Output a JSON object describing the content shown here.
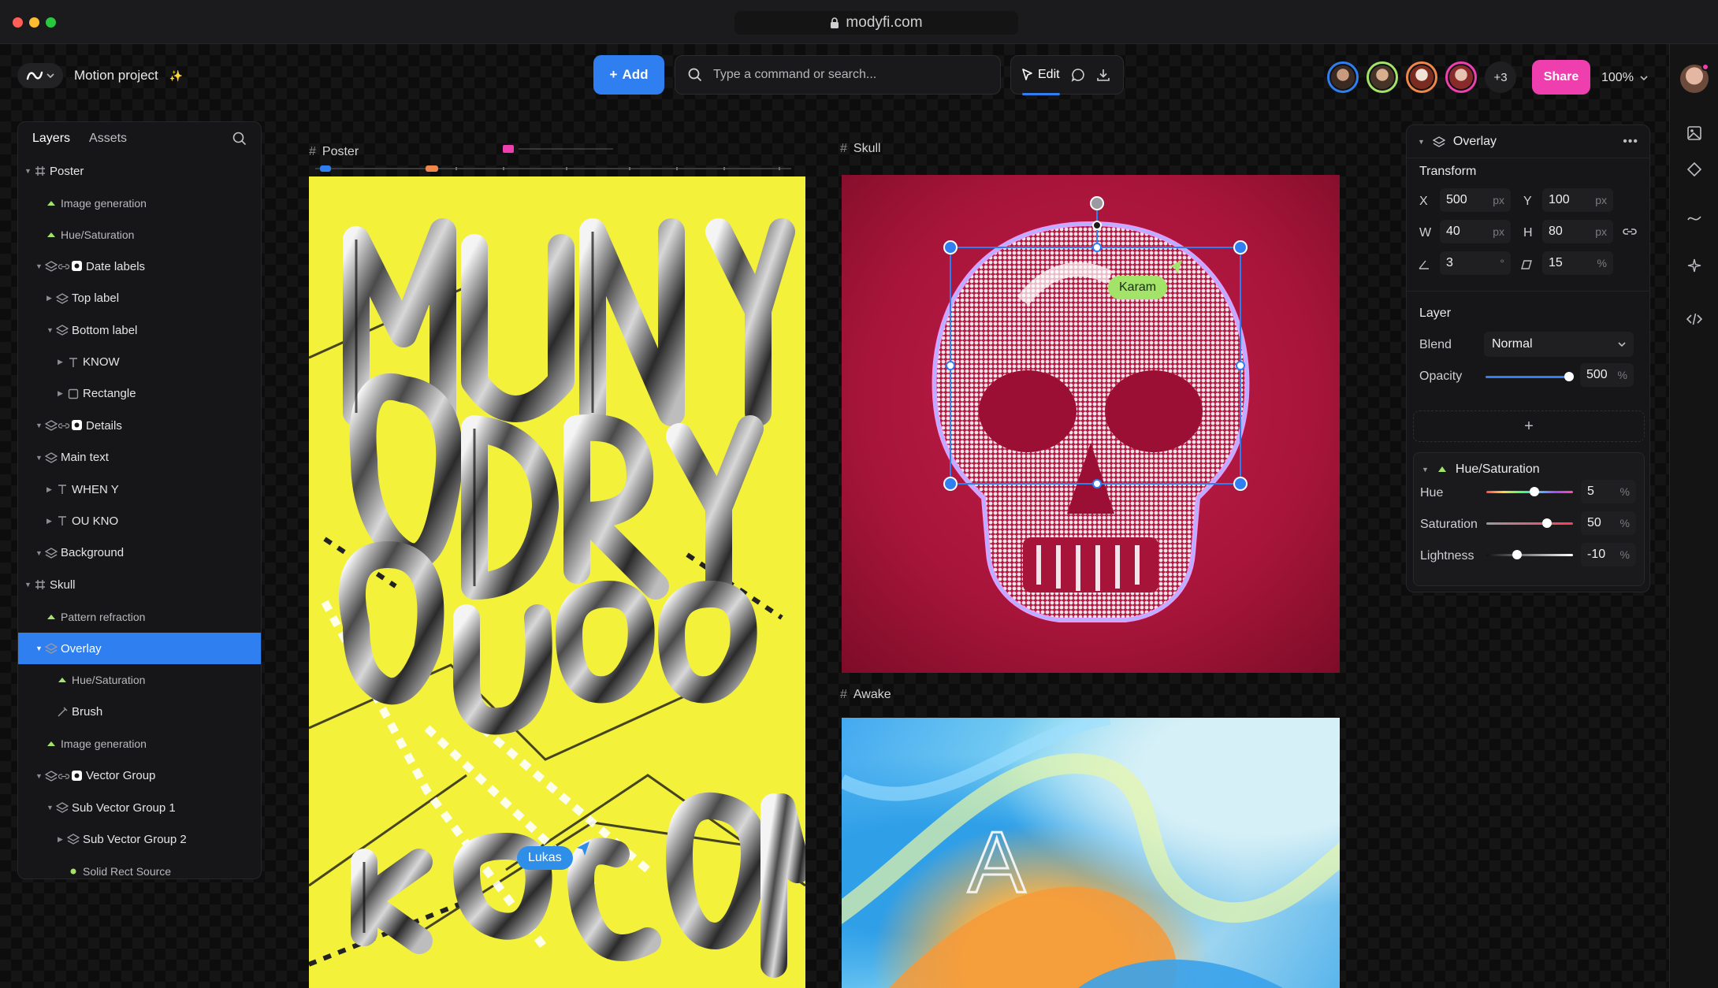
{
  "browser": {
    "url": "modyfi.com"
  },
  "header": {
    "project_title": "Motion project",
    "add_label": "Add",
    "search_placeholder": "Type a command or search...",
    "edit_label": "Edit",
    "avatars_more": "+3",
    "share_label": "Share",
    "zoom": "100%"
  },
  "layers": {
    "tabs": [
      "Layers",
      "Assets"
    ],
    "items": [
      {
        "label": "Poster",
        "type": "frame",
        "depth": 0,
        "caret": true
      },
      {
        "label": "Image generation",
        "type": "gen",
        "depth": 1,
        "caret": false,
        "small": true
      },
      {
        "label": "Hue/Saturation",
        "type": "adjust",
        "depth": 1,
        "caret": false,
        "small": true
      },
      {
        "label": "Date labels",
        "type": "group-linked",
        "depth": 1,
        "caret": true
      },
      {
        "label": "Top label",
        "type": "stack",
        "depth": 2,
        "caret": true
      },
      {
        "label": "Bottom label",
        "type": "stack",
        "depth": 2,
        "caret": true
      },
      {
        "label": "KNOW",
        "type": "text",
        "depth": 3,
        "caret": true
      },
      {
        "label": "Rectangle",
        "type": "rect",
        "depth": 3,
        "caret": true
      },
      {
        "label": "Details",
        "type": "group-linked",
        "depth": 1,
        "caret": true
      },
      {
        "label": "Main text",
        "type": "stack",
        "depth": 1,
        "caret": true
      },
      {
        "label": "WHEN Y",
        "type": "text",
        "depth": 2,
        "caret": true
      },
      {
        "label": "OU KNO",
        "type": "text",
        "depth": 2,
        "caret": true
      },
      {
        "label": "Background",
        "type": "stack",
        "depth": 1,
        "caret": true
      },
      {
        "label": "Skull",
        "type": "frame",
        "depth": 0,
        "caret": true
      },
      {
        "label": "Pattern refraction",
        "type": "gen",
        "depth": 1,
        "caret": false,
        "small": true
      },
      {
        "label": "Overlay",
        "type": "stack",
        "depth": 1,
        "caret": true,
        "selected": true
      },
      {
        "label": "Hue/Saturation",
        "type": "adjust",
        "depth": 2,
        "caret": false,
        "small": true
      },
      {
        "label": "Brush",
        "type": "brush",
        "depth": 2,
        "caret": false
      },
      {
        "label": "Image generation",
        "type": "gen",
        "depth": 1,
        "caret": false,
        "small": true
      },
      {
        "label": "Vector Group",
        "type": "group-linked",
        "depth": 1,
        "caret": true
      },
      {
        "label": "Sub Vector Group 1",
        "type": "stack",
        "depth": 2,
        "caret": true
      },
      {
        "label": "Sub Vector Group 2",
        "type": "stack",
        "depth": 3,
        "caret": true
      },
      {
        "label": "Solid Rect Source",
        "type": "dot",
        "depth": 3,
        "caret": false,
        "small": true
      }
    ]
  },
  "canvas": {
    "frames": {
      "poster": "Poster",
      "skull": "Skull",
      "awake": "Awake"
    },
    "cursors": {
      "karam": "Karam",
      "lukas": "Lukas"
    },
    "awake_letter": "A"
  },
  "inspector": {
    "title": "Overlay",
    "transform": {
      "title": "Transform",
      "x_label": "X",
      "x": "500",
      "x_unit": "px",
      "y_label": "Y",
      "y": "100",
      "y_unit": "px",
      "w_label": "W",
      "w": "40",
      "w_unit": "px",
      "h_label": "H",
      "h": "80",
      "h_unit": "px",
      "rotation": "3",
      "rotation_unit": "°",
      "skew": "15",
      "skew_unit": "%"
    },
    "layer": {
      "title": "Layer",
      "blend_label": "Blend",
      "blend": "Normal",
      "opacity_label": "Opacity",
      "opacity": "500",
      "opacity_unit": "%",
      "opacity_fill": 0.96
    },
    "hue_saturation": {
      "title": "Hue/Saturation",
      "hue_label": "Hue",
      "hue": "5",
      "hue_unit": "%",
      "hue_pos": 0.55,
      "saturation_label": "Saturation",
      "saturation": "50",
      "saturation_unit": "%",
      "saturation_pos": 0.7,
      "lightness_label": "Lightness",
      "lightness": "-10",
      "lightness_unit": "%",
      "lightness_pos": 0.35
    }
  },
  "colors": {
    "accent": "#2f7ff0",
    "share": "#ef3fae",
    "poster_bg": "#f3f139",
    "skull_bg": "#b0183e",
    "cursor_karam": "#a4e36a",
    "cursor_lukas": "#2f8fe8"
  }
}
